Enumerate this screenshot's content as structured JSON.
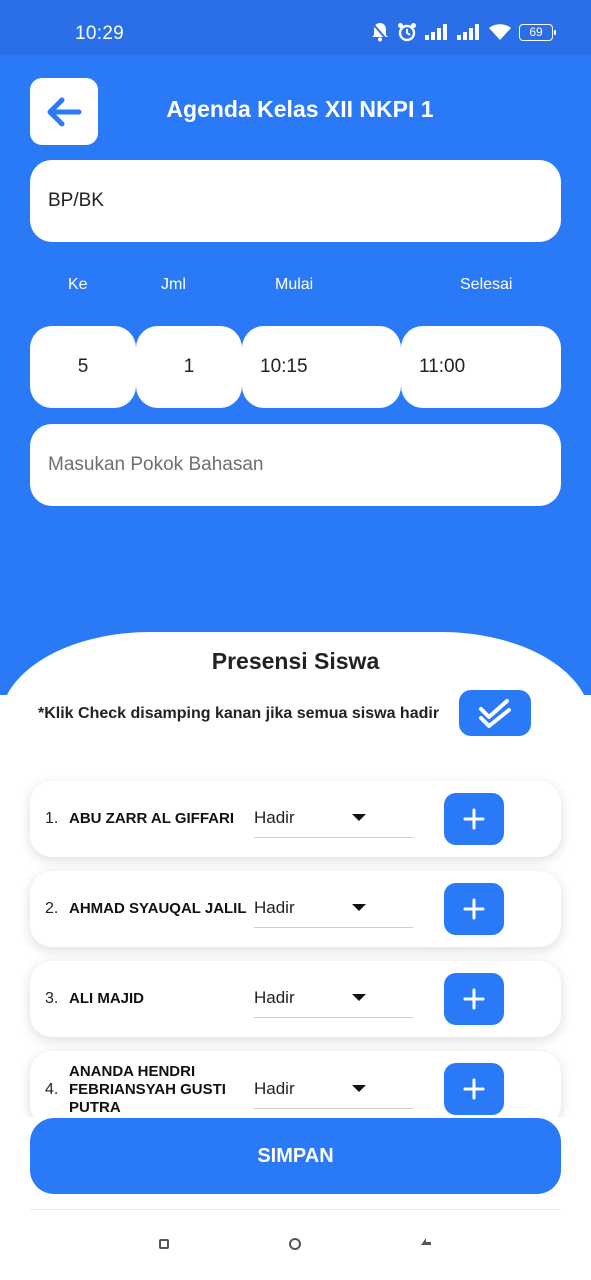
{
  "status_bar": {
    "time": "10:29",
    "battery": "69"
  },
  "header": {
    "title": "Agenda Kelas XII NKPI 1"
  },
  "form": {
    "subject": "BP/BK",
    "labels": {
      "ke": "Ke",
      "jml": "Jml",
      "mulai": "Mulai",
      "selesai": "Selesai"
    },
    "values": {
      "ke": "5",
      "jml": "1",
      "mulai": "10:15",
      "selesai": "11:00"
    },
    "topic_placeholder": "Masukan Pokok Bahasan"
  },
  "attendance": {
    "title": "Presensi Siswa",
    "hint": "*Klik Check disamping kanan jika semua siswa hadir",
    "students": [
      {
        "num": "1.",
        "name": "ABU ZARR AL GIFFARI",
        "status": "Hadir"
      },
      {
        "num": "2.",
        "name": "AHMAD SYAUQAL JALIL",
        "status": "Hadir"
      },
      {
        "num": "3.",
        "name": "ALI MAJID",
        "status": "Hadir"
      },
      {
        "num": "4.",
        "name": "ANANDA HENDRI FEBRIANSYAH GUSTI PUTRA",
        "status": "Hadir"
      }
    ]
  },
  "save_label": "SIMPAN",
  "colors": {
    "primary": "#2a79f6",
    "status_bar": "#2a6ee8"
  }
}
